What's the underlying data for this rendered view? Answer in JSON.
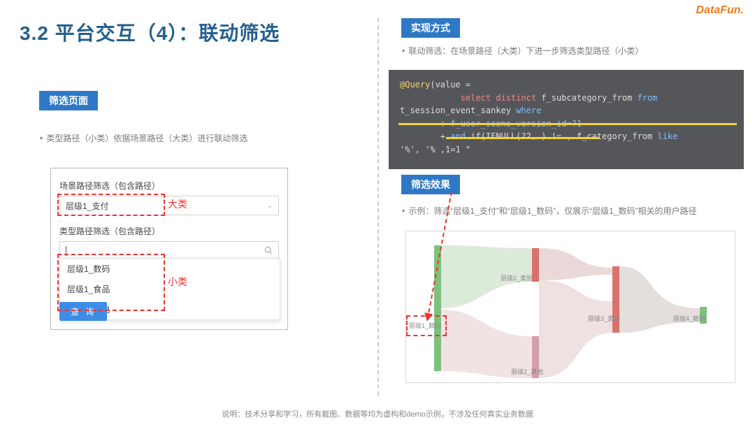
{
  "logo_text": "DataFun.",
  "slide_title": "3.2 平台交互（4）：联动筛选",
  "left": {
    "badge": "筛选页面",
    "bullet": "类型路径（小类）依据场景路径（大类）进行联动筛选",
    "field1_label": "场景路径筛选（包含路径）",
    "field1_value": "层级1_支付",
    "big_label": "大类",
    "field2_label": "类型路径筛选（包含路径）",
    "dropdown_options": [
      "层级1_数码",
      "层级1_食品",
      "层级1_家电"
    ],
    "small_label": "小类",
    "query_btn": "查 询"
  },
  "right": {
    "badge1": "实现方式",
    "bullet1": "联动筛选：在场景路径（大类）下进一步筛选类型路径（小类）",
    "code": {
      "l1a": "@Query",
      "l1b": "(value = ",
      "l2a": "select distinct",
      "l2b": " f_subcategory_from ",
      "l2c": "from",
      "l3": "t_session_event_sankey ",
      "l3w": "where",
      "l4a": "        + ",
      "l4b": "f_user_scene_version_id=?1",
      "l5a": "        + ",
      "l5b": "and",
      "l5c": " if(IFNULL(?2, ) != , f_category_from ",
      "l5d": "like",
      "l6": "'%', '% ,1=1 \""
    },
    "badge2": "筛选效果",
    "bullet2": "示例：筛选“层级1_支付”和“层级1_数码”，仅展示“层级1_数码”相关的用户路径",
    "sankey_labels": {
      "n1": "层级1_数码",
      "n2a": "层级2_类别",
      "n2b": "层级2_其他",
      "n3": "层级3_类别",
      "n4": "层级4_数码"
    }
  },
  "footer": "说明：技术分享和学习，所有截图、数据等均为虚构和demo示例，不涉及任何真实业务数据"
}
